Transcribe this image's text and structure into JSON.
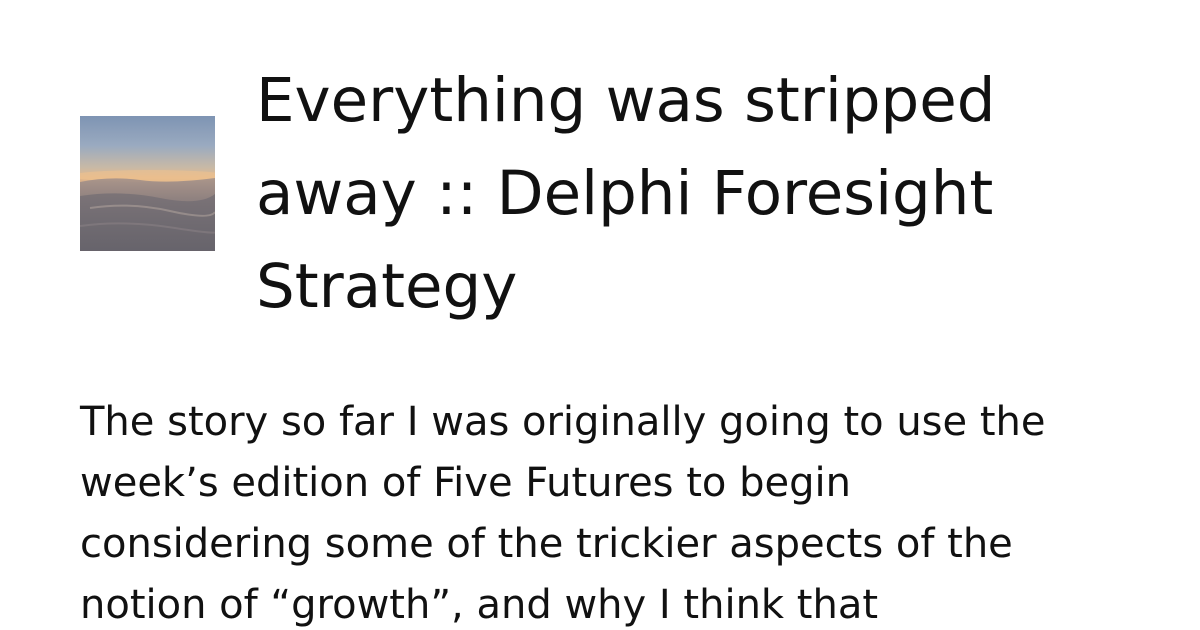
{
  "card": {
    "thumbnail_icon": "landscape-sunset-photo",
    "title": "Everything was stripped away :: Delphi Foresight Strategy",
    "excerpt": "The story so far I was originally going to use the week’s edition of Five Futures to begin considering some of the trickier aspects of the notion of “growth”, and why I think that"
  },
  "colors": {
    "background": "#ffffff",
    "text": "#111111"
  }
}
